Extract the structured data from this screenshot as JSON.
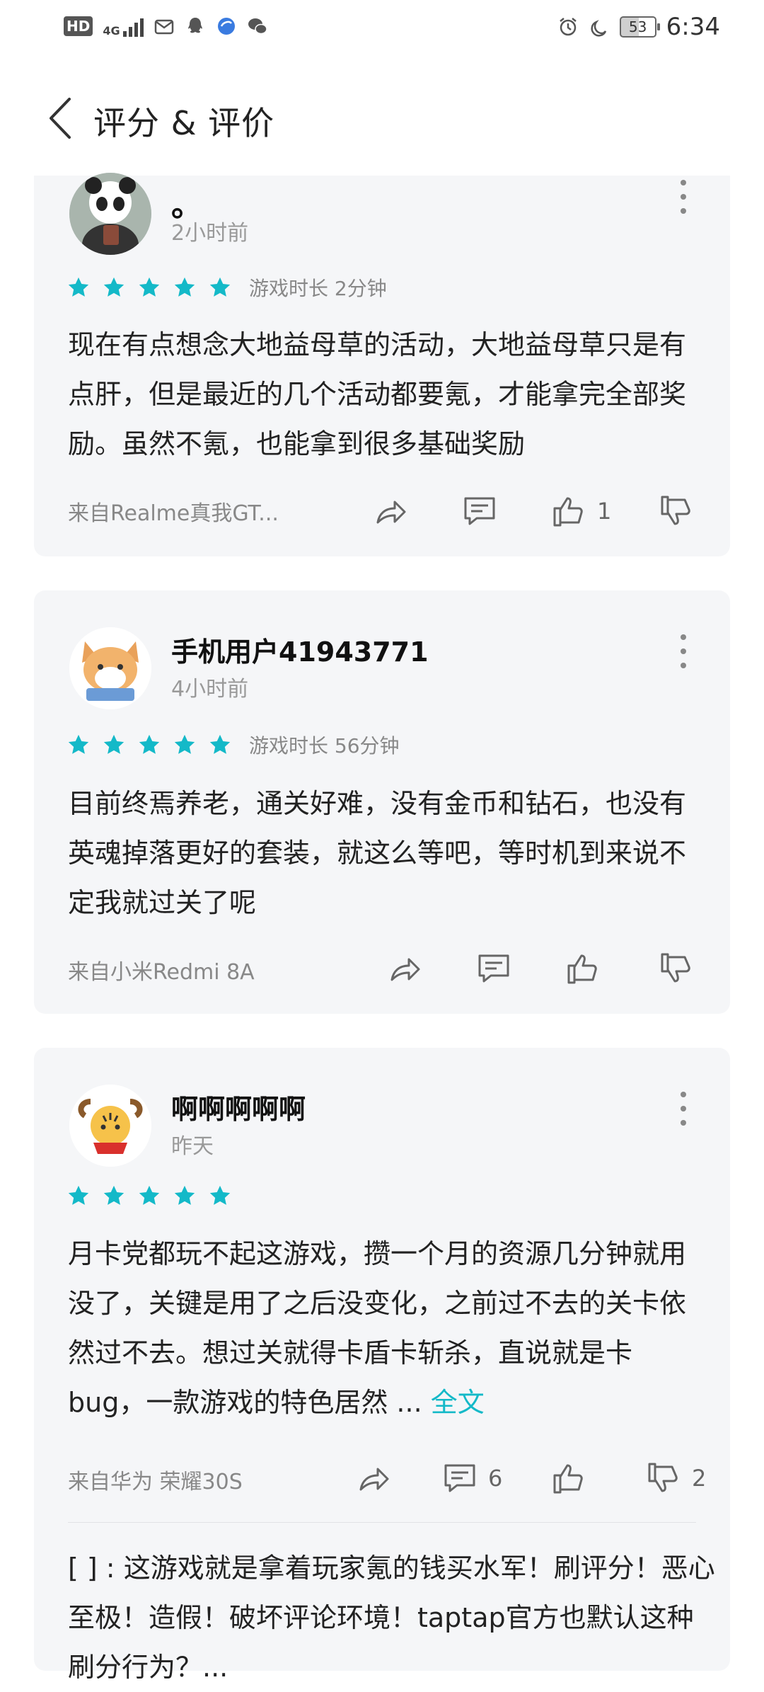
{
  "status_bar": {
    "left_icons": [
      "hd-icon",
      "4g-signal-icon",
      "mail-icon",
      "qq-icon",
      "browser-icon",
      "wechat-icon"
    ],
    "hd": "HD",
    "network": "4G",
    "battery": "53",
    "time": "6:34"
  },
  "header": {
    "title": "评分 & 评价"
  },
  "colors": {
    "accent": "#14b9c8",
    "card_bg": "#f5f6f8",
    "star": "#14b9c8"
  },
  "reviews": [
    {
      "name": "。",
      "time": "2小时前",
      "rating": 5,
      "playtime": "游戏时长 2分钟",
      "content": "现在有点想念大地益母草的活动，大地益母草只是有点肝，但是最近的几个活动都要氪，才能拿完全部奖励。虽然不氪，也能拿到很多基础奖励",
      "device": "来自Realme真我GT...",
      "comments": "",
      "likes": "1",
      "dislikes": ""
    },
    {
      "name": "手机用户41943771",
      "time": "4小时前",
      "rating": 5,
      "playtime": "游戏时长 56分钟",
      "content": "目前终焉养老，通关好难，没有金币和钻石，也没有英魂掉落更好的套装，就这么等吧，等时机到来说不定我就过关了呢",
      "device": "来自小米Redmi 8A",
      "comments": "",
      "likes": "",
      "dislikes": ""
    },
    {
      "name": "啊啊啊啊啊",
      "time": "昨天",
      "rating": 5,
      "playtime": "",
      "content": "月卡党都玩不起这游戏，攒一个月的资源几分钟就用没了，关键是用了之后没变化，之前过不去的关卡依然过不去。想过关就得卡盾卡斩杀，直说就是卡bug，一款游戏的特色居然 ... ",
      "more_label": "全文",
      "device": "来自华为 荣耀30S",
      "comments": "6",
      "likes": "",
      "dislikes": "2",
      "reply": "[      ] : 这游戏就是拿着玩家氪的钱买水军！刷评分！恶心至极！造假！破坏评论环境！taptap官方也默认这种刷分行为？..."
    }
  ]
}
